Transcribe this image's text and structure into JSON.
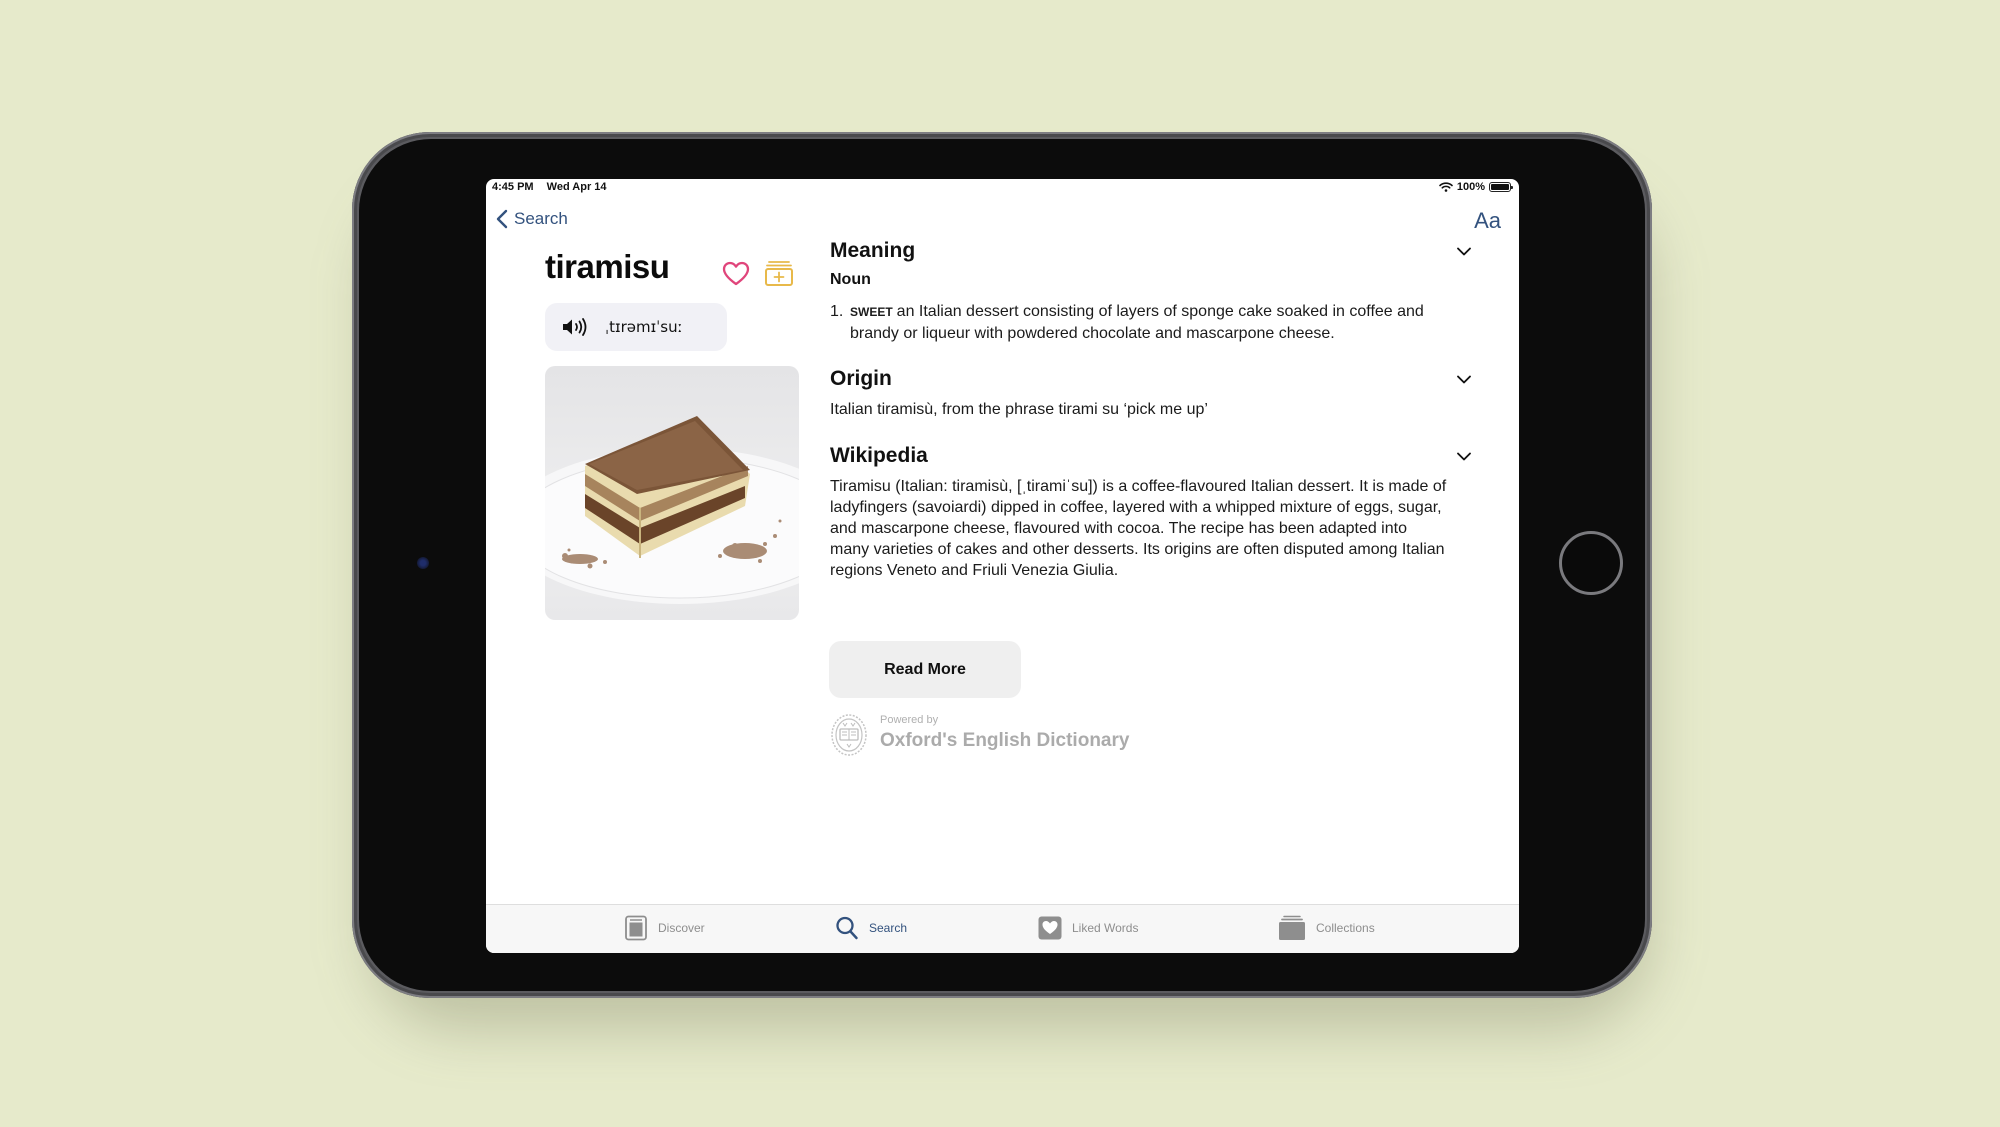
{
  "status_bar": {
    "time": "4:45 PM",
    "date": "Wed Apr 14",
    "battery": "100%",
    "battery_level": 1.0
  },
  "nav": {
    "back_label": "Search",
    "font_button_label": "Aa"
  },
  "word": {
    "title": "tiramisu",
    "pronunciation": "ˌtɪrəmɪˈsuː",
    "image_alt": "Slice of tiramisu on a white plate dusted with cocoa",
    "liked": false
  },
  "sections": {
    "meaning": {
      "title": "Meaning",
      "part_of_speech": "Noun",
      "definitions": [
        {
          "number": "1.",
          "tag": "SWEET",
          "text": "an Italian dessert consisting of layers of sponge cake soaked in coffee and brandy or liqueur with powdered chocolate and mascarpone cheese."
        }
      ]
    },
    "origin": {
      "title": "Origin",
      "text": "Italian tiramisù, from the phrase tirami su ‘pick me up’"
    },
    "wikipedia": {
      "title": "Wikipedia",
      "text": "Tiramisu (Italian: tiramisù, [ˌtiramiˈsu]) is a coffee-flavoured Italian dessert. It is made of ladyfingers (savoiardi) dipped in coffee, layered with a whipped mixture of eggs, sugar, and mascarpone cheese, flavoured with cocoa. The recipe has been adapted into many varieties of cakes and other desserts. Its origins are often disputed among Italian regions Veneto and Friuli Venezia Giulia."
    }
  },
  "read_more_label": "Read More",
  "attribution": {
    "powered_by": "Powered by",
    "source": "Oxford's English Dictionary"
  },
  "tab_bar": {
    "tabs": [
      {
        "label": "Discover",
        "icon": "book-icon",
        "active": false
      },
      {
        "label": "Search",
        "icon": "search-icon",
        "active": true
      },
      {
        "label": "Liked Words",
        "icon": "heart-square-icon",
        "active": false
      },
      {
        "label": "Collections",
        "icon": "stack-icon",
        "active": false
      }
    ]
  },
  "colors": {
    "accent": "#33527e",
    "like": "#e0457b",
    "collection": "#e8b94a",
    "background": "#e6eacb",
    "tab_inactive": "#8e8e8e"
  }
}
